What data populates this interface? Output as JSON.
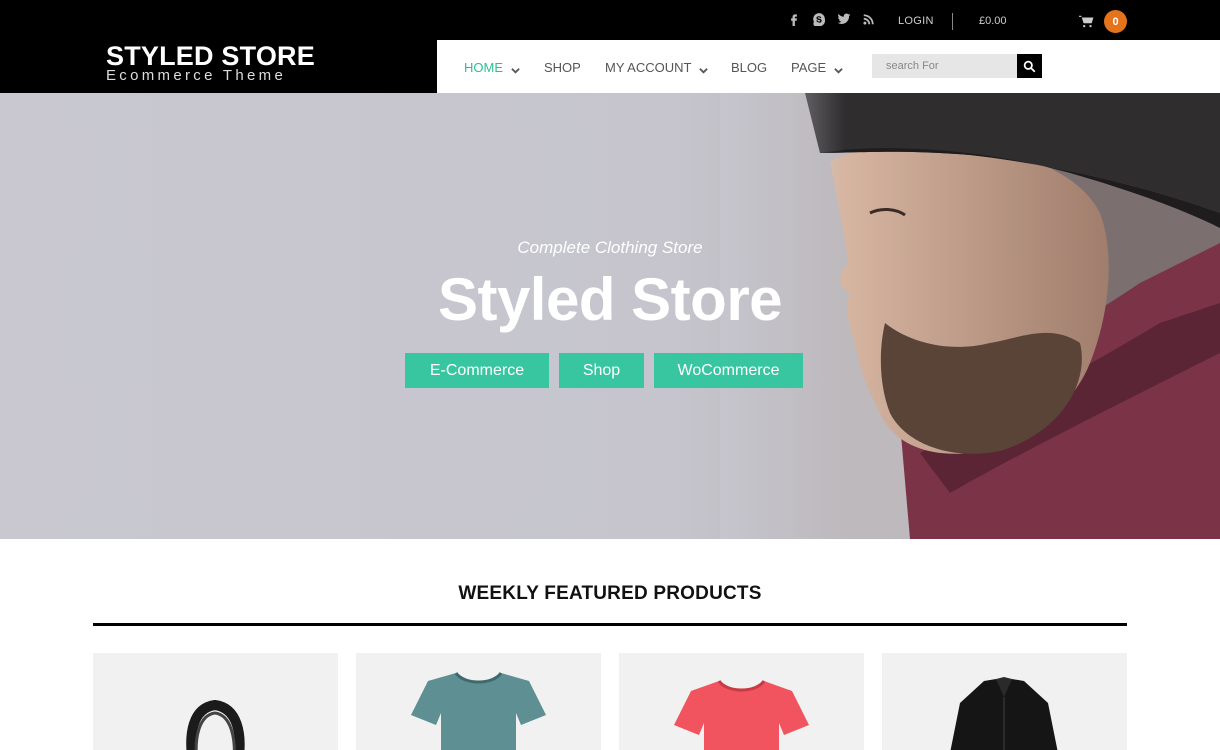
{
  "topbar": {
    "social_icons": [
      "facebook-icon",
      "skype-icon",
      "twitter-icon",
      "rss-icon"
    ],
    "login_label": "LOGIN",
    "cart_total": "£0.00",
    "cart_count": "0"
  },
  "brand": {
    "title": "STYLED STORE",
    "subtitle": "Ecommerce Theme"
  },
  "nav": {
    "items": [
      {
        "label": "HOME",
        "active": true,
        "dropdown": true
      },
      {
        "label": "SHOP",
        "active": false,
        "dropdown": false
      },
      {
        "label": "MY ACCOUNT",
        "active": false,
        "dropdown": true
      },
      {
        "label": "BLOG",
        "active": false,
        "dropdown": false
      },
      {
        "label": "PAGE",
        "active": false,
        "dropdown": true
      }
    ],
    "search_placeholder": "search For"
  },
  "hero": {
    "kicker": "Complete Clothing Store",
    "title": "Styled Store",
    "buttons": [
      "E-Commerce",
      "Shop",
      "WoCommerce"
    ]
  },
  "featured": {
    "title": "WEEKLY FEATURED PRODUCTS",
    "products": [
      {
        "name": "handbag",
        "color": "#1b1b1b"
      },
      {
        "name": "t-shirt-teal",
        "color": "#5e8f93"
      },
      {
        "name": "t-shirt-red",
        "color": "#f1545e"
      },
      {
        "name": "shirt-black",
        "color": "#151515"
      }
    ]
  },
  "colors": {
    "accent": "#2bbf98",
    "button": "#37c6a0",
    "cart_badge": "#e4731b"
  }
}
